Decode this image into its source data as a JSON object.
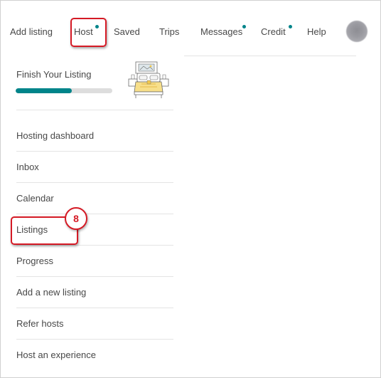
{
  "nav": {
    "items": [
      {
        "label": "Add listing",
        "dot": false
      },
      {
        "label": "Host",
        "dot": true
      },
      {
        "label": "Saved",
        "dot": false
      },
      {
        "label": "Trips",
        "dot": false
      },
      {
        "label": "Messages",
        "dot": true
      },
      {
        "label": "Credit",
        "dot": true
      },
      {
        "label": "Help",
        "dot": false
      }
    ],
    "accent_color": "#00848a"
  },
  "finish_listing": {
    "title": "Finish Your Listing",
    "progress": 0.58
  },
  "menu": {
    "items": [
      {
        "label": "Hosting dashboard"
      },
      {
        "label": "Inbox"
      },
      {
        "label": "Calendar"
      },
      {
        "label": "Listings"
      },
      {
        "label": "Progress"
      },
      {
        "label": "Add a new listing"
      },
      {
        "label": "Refer hosts"
      },
      {
        "label": "Host an experience"
      }
    ]
  },
  "annotation": {
    "step_number": "8",
    "color": "#d51a25"
  }
}
